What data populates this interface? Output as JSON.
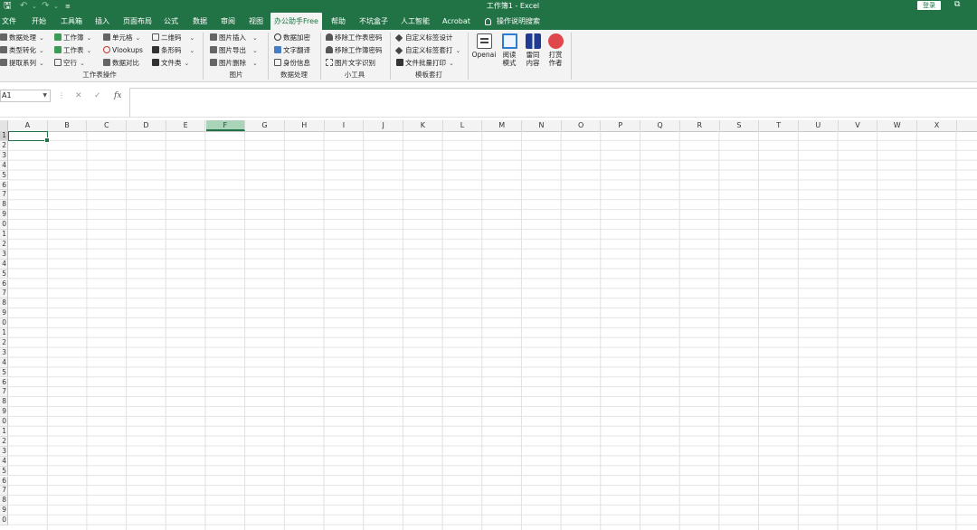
{
  "titlebar": {
    "title": "工作簿1  -  Excel",
    "login_label": "登录"
  },
  "tabs": [
    {
      "label": "文件"
    },
    {
      "label": "开始"
    },
    {
      "label": "工具箱"
    },
    {
      "label": "插入"
    },
    {
      "label": "页面布局"
    },
    {
      "label": "公式"
    },
    {
      "label": "数据"
    },
    {
      "label": "审阅"
    },
    {
      "label": "视图"
    },
    {
      "label": "办公助手Free",
      "active": true
    },
    {
      "label": "帮助"
    },
    {
      "label": "不坑盒子"
    },
    {
      "label": "人工智能"
    },
    {
      "label": "Acrobat"
    },
    {
      "label": "操作说明搜索"
    }
  ],
  "ribbon": {
    "worksheet_ops": {
      "label": "工作表操作",
      "items": [
        "数据处理",
        "类型转化",
        "提取系列",
        "工作簿",
        "工作表",
        "空行",
        "单元格",
        "Vlookups",
        "数据对比",
        "二维码",
        "条形码",
        "文件类"
      ]
    },
    "picture": {
      "label": "图片",
      "items": [
        "图片插入",
        "图片导出",
        "图片删除"
      ]
    },
    "data_processing": {
      "label": "数据处理",
      "items": [
        "数据加密",
        "文字翻译",
        "身份信息"
      ]
    },
    "small_tools": {
      "label": "小工具",
      "items": [
        "移除工作表密码",
        "移除工作簿密码",
        "图片文字识别"
      ]
    },
    "template": {
      "label": "模板套打",
      "items": [
        "自定义标签设计",
        "自定义标签套打",
        "文件批量打印"
      ]
    },
    "big_buttons": [
      {
        "line1": "Openai",
        "line2": ""
      },
      {
        "line1": "阅读",
        "line2": "模式"
      },
      {
        "line1": "雷同",
        "line2": "内容"
      },
      {
        "line1": "打赏",
        "line2": "作者"
      }
    ]
  },
  "formula_bar": {
    "name_box": "A1",
    "cancel_symbol": "✕",
    "enter_symbol": "✓",
    "fx_symbol": "fx",
    "value": ""
  },
  "sheet": {
    "columns": [
      "A",
      "B",
      "C",
      "D",
      "E",
      "F",
      "G",
      "H",
      "I",
      "J",
      "K",
      "L",
      "M",
      "N",
      "O",
      "P",
      "Q",
      "R",
      "S",
      "T",
      "U",
      "V",
      "W",
      "X"
    ],
    "selected_column": "F",
    "selected_cell": "A1",
    "row_numbers_visible": [
      "1",
      "2",
      "3",
      "4",
      "5",
      "6",
      "7",
      "8",
      "9",
      "0",
      "1",
      "2",
      "3",
      "4",
      "5",
      "6",
      "7",
      "8",
      "9",
      "0",
      "1",
      "2",
      "3",
      "4",
      "5",
      "6",
      "7",
      "8",
      "9",
      "0",
      "1",
      "2",
      "3",
      "4",
      "5",
      "6",
      "7",
      "8",
      "9",
      "0"
    ]
  },
  "colors": {
    "accent": "#217346",
    "selected_header": "#a9d4b9",
    "ribbon_bg": "#f3f3f3"
  }
}
